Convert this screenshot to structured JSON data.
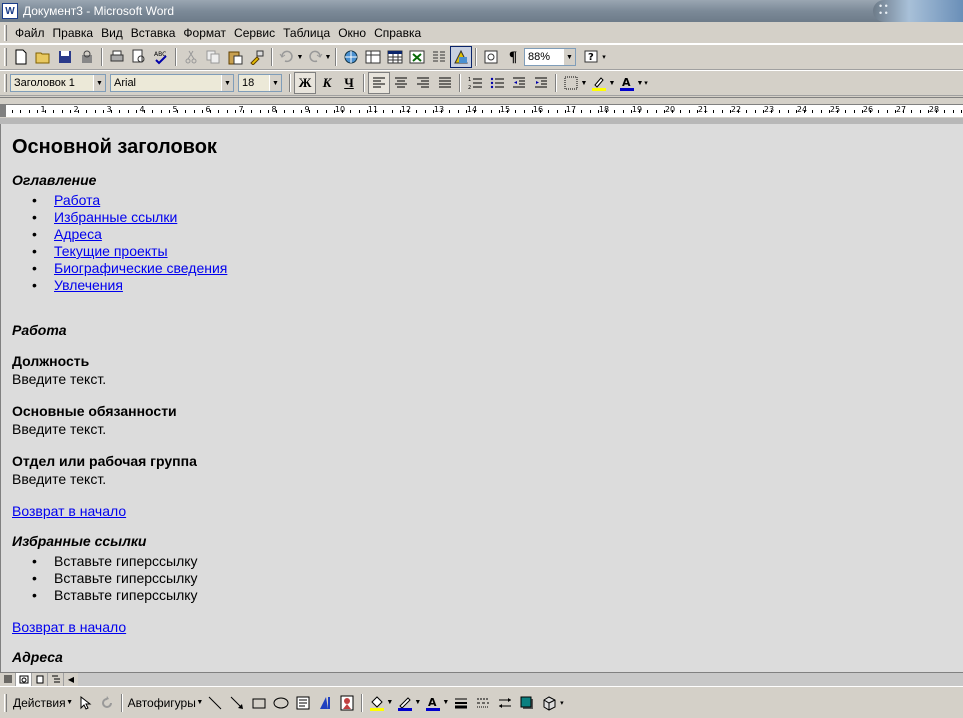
{
  "window": {
    "title": "Документ3 - Microsoft Word",
    "app_icon": "W"
  },
  "menu": {
    "items": [
      "Файл",
      "Правка",
      "Вид",
      "Вставка",
      "Формат",
      "Сервис",
      "Таблица",
      "Окно",
      "Справка"
    ]
  },
  "standard_toolbar": {
    "zoom": "88%"
  },
  "formatting_toolbar": {
    "style": "Заголовок 1",
    "font": "Arial",
    "size": "18",
    "bold_label": "Ж",
    "italic_label": "К",
    "underline_label": "Ч"
  },
  "ruler": {
    "numbers": [
      "1",
      "2",
      "3",
      "4",
      "5",
      "6",
      "7",
      "8",
      "9",
      "10",
      "11",
      "12",
      "13",
      "14",
      "15",
      "16",
      "17",
      "18",
      "19",
      "20",
      "21",
      "22",
      "23",
      "24",
      "25",
      "26",
      "27",
      "28"
    ]
  },
  "document": {
    "title": "Основной заголовок",
    "toc_heading": "Оглавление",
    "toc": [
      "Работа",
      "Избранные ссылки",
      "Адреса",
      "Текущие проекты",
      "Биографические сведения",
      "Увлечения"
    ],
    "work_heading": "Работа",
    "position_label": "Должность",
    "position_text": "Введите текст.",
    "duties_label": "Основные обязанности",
    "duties_text": "Введите текст.",
    "dept_label": "Отдел или рабочая группа",
    "dept_text": "Введите текст.",
    "back_link_1": "Возврат в начало",
    "favorites_heading": "Избранные ссылки",
    "favorites": [
      "Вставьте гиперссылку",
      "Вставьте гиперссылку",
      "Вставьте гиперссылку"
    ],
    "back_link_2": "Возврат в начало",
    "addresses_heading": "Адреса"
  },
  "drawing_toolbar": {
    "actions_label": "Действия",
    "autoshapes_label": "Автофигуры"
  },
  "colors": {
    "link": "#0000ee",
    "highlight": "#ffff00",
    "font_color": "#0000cc"
  }
}
